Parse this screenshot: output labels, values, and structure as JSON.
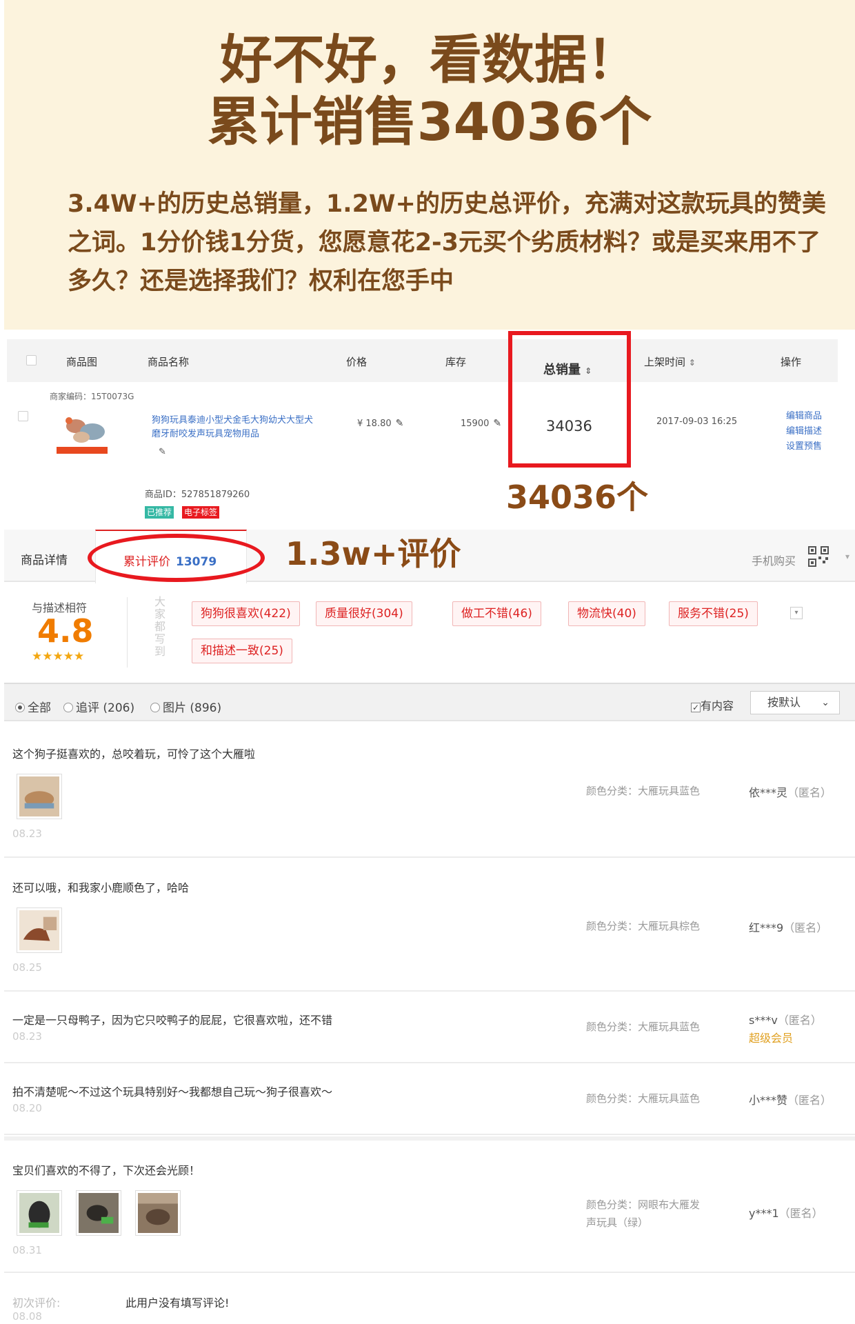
{
  "banner": {
    "title_line1": "好不好，看数据！",
    "title_line2": "累计销售34036个",
    "description": "3.4W+的历史总销量，1.2W+的历史总评价，充满对这款玩具的赞美之词。1分价钱1分货，您愿意花2-3元买个劣质材料？或是买来用不了多久？还是选择我们？权利在您手中"
  },
  "table": {
    "headers": {
      "image": "商品图",
      "name": "商品名称",
      "price": "价格",
      "stock": "库存",
      "total_sales": "总销量",
      "listed_time": "上架时间",
      "actions": "操作"
    },
    "product": {
      "merchant_code": "商家编码：15T0073G",
      "name": "狗狗玩具泰迪小型犬金毛大狗幼犬大型犬磨牙耐咬发声玩具宠物用品",
      "price": "¥ 18.80",
      "stock": "15900",
      "total_sales": "34036",
      "listed_time": "2017-09-03 16:25",
      "product_id": "商品ID：527851879260",
      "tag_recommended": "已推荐",
      "tag_electronic": "电子标签",
      "actions": [
        "编辑商品",
        "编辑描述",
        "设置预售"
      ]
    },
    "sales_note": "34036个"
  },
  "tabs": {
    "details": "商品详情",
    "reviews_label": "累计评价",
    "reviews_count": "13079",
    "review_note": "1.3w+评价",
    "mobile_buy": "手机购买"
  },
  "rating": {
    "label": "与描述相符",
    "score": "4.8",
    "stars": "★★★★★",
    "vertical_label": "大家都写到",
    "tags": [
      "狗狗很喜欢(422)",
      "质量很好(304)",
      "做工不错(46)",
      "物流快(40)",
      "服务不错(25)",
      "和描述一致(25)"
    ]
  },
  "filter": {
    "all": "全部",
    "followup": "追评 (206)",
    "pictures": "图片 (896)",
    "has_content": "有内容",
    "sort": "按默认"
  },
  "reviews": [
    {
      "text": "这个狗子挺喜欢的，总咬着玩，可怜了这个大雁啦",
      "date": "08.23",
      "color": "颜色分类：大雁玩具蓝色",
      "user": "依***灵",
      "anon": "（匿名）"
    },
    {
      "text": "还可以哦，和我家小鹿顺色了，哈哈",
      "date": "08.25",
      "color": "颜色分类：大雁玩具棕色",
      "user": "红***9",
      "anon": "（匿名）"
    },
    {
      "text": "一定是一只母鸭子，因为它只咬鸭子的屁屁，它很喜欢啦，还不错",
      "date": "08.23",
      "color": "颜色分类：大雁玩具蓝色",
      "user": "s***v",
      "anon": "（匿名）",
      "vip": "超级会员"
    },
    {
      "text": "拍不清楚呢～不过这个玩具特别好～我都想自己玩～狗子很喜欢～",
      "date": "08.20",
      "color": "颜色分类：大雁玩具蓝色",
      "user": "小***赞",
      "anon": "（匿名）"
    },
    {
      "text": "宝贝们喜欢的不得了，下次还会光顾！",
      "date": "08.31",
      "color_line1": "颜色分类：网眼布大雁发",
      "color_line2": "声玩具（绿）",
      "user": "y***1",
      "anon": "（匿名）"
    }
  ],
  "initial_review": {
    "label": "初次评价:",
    "text": "此用户没有填写评论!",
    "date": "08.08"
  }
}
